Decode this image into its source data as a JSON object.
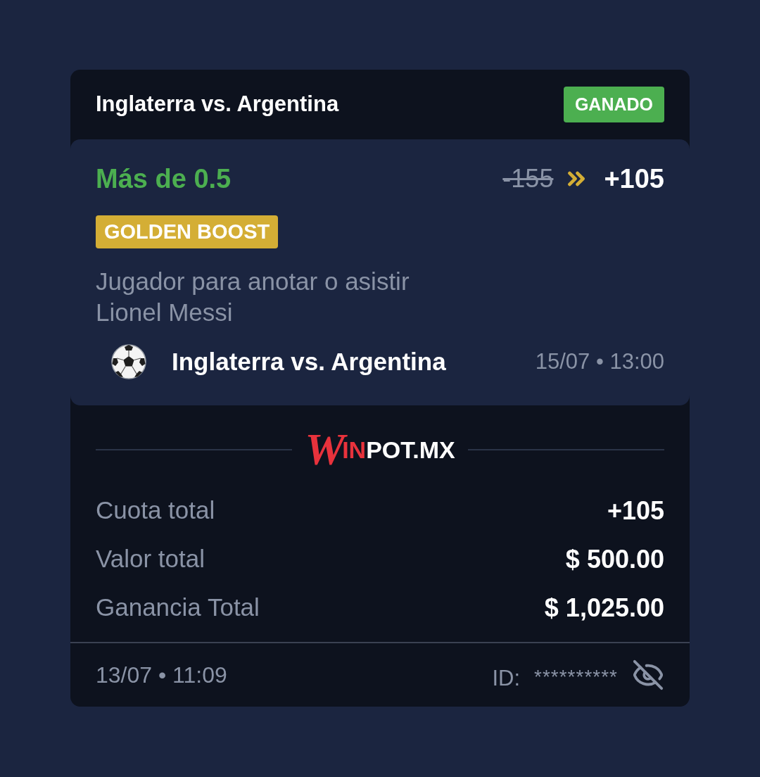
{
  "bet": {
    "header": {
      "title": "Inglaterra vs. Argentina",
      "status": {
        "label": "GANADO",
        "kind": "won"
      }
    },
    "selection": {
      "market": "Más de 0.5",
      "old_odds": "-155",
      "odds": "+105",
      "boost": "GOLDEN BOOST",
      "description": "Jugador para anotar o asistir",
      "player": "Lionel Messi",
      "event": {
        "title": "Inglaterra vs. Argentina",
        "time": "15/07 • 13:00"
      }
    },
    "logo": {
      "parts": [
        {
          "text": "W",
          "kind": "script"
        },
        {
          "text": "IN",
          "kind": "accent"
        },
        {
          "text": "POT.MX",
          "kind": "plain"
        }
      ]
    },
    "summary": [
      {
        "label": "Cuota total",
        "value": "+105"
      },
      {
        "label": "Valor total",
        "value": "$ 500.00"
      },
      {
        "label": "Ganancia Total",
        "value": "$ 1,025.00"
      }
    ],
    "footer": {
      "placed": "13/07 • 11:09",
      "id_label": "ID:",
      "id_value": "**********",
      "id_hidden": true
    }
  }
}
